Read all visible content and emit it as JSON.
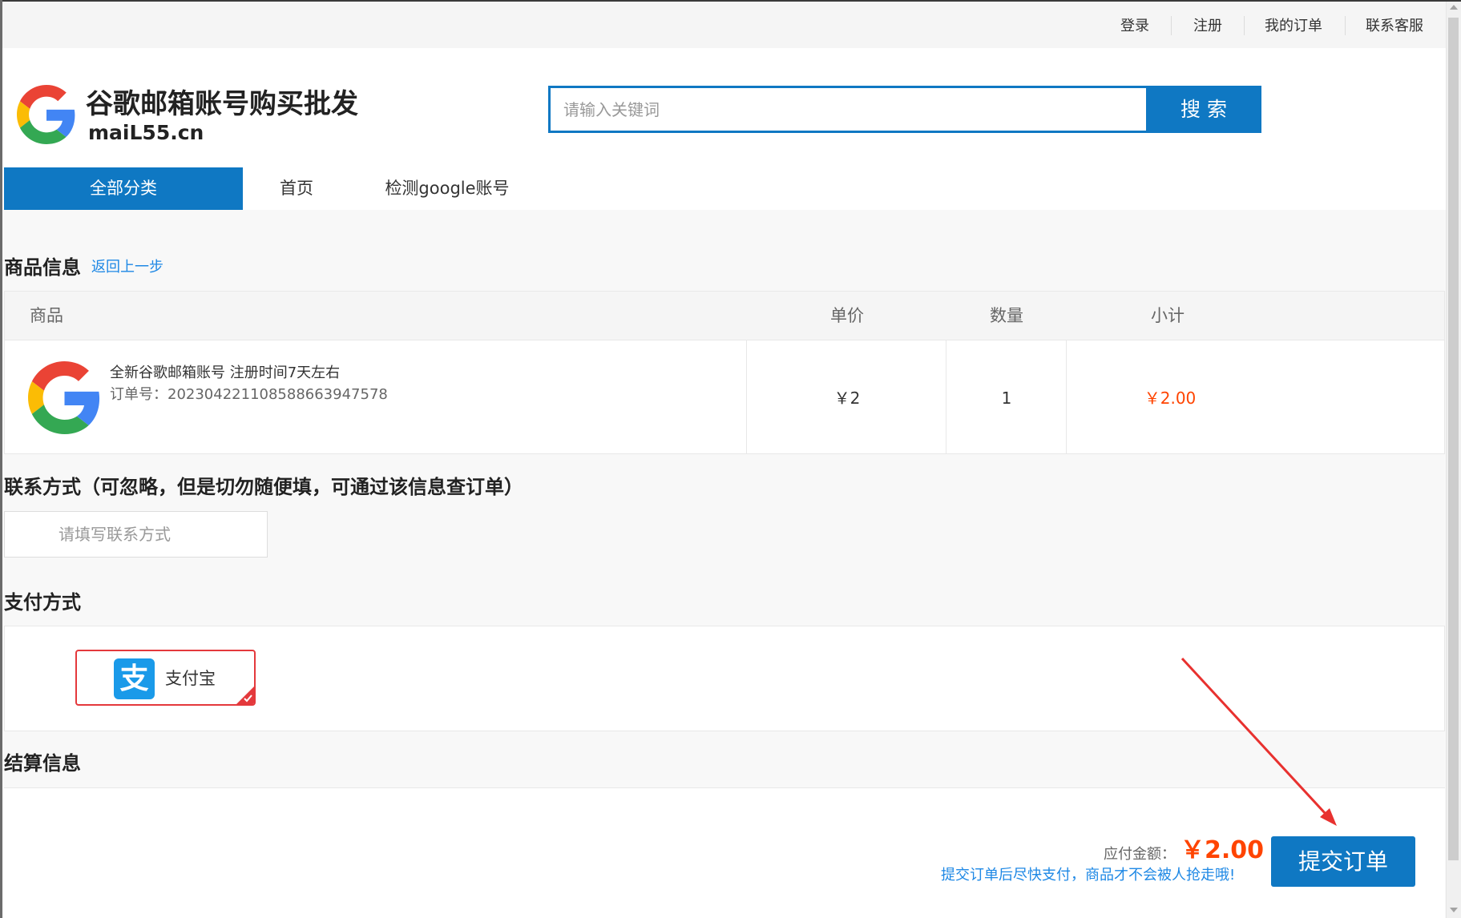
{
  "colors": {
    "accent": "#0f78c3",
    "price": "#ff4400",
    "link": "#1e88e5",
    "selected_border": "#e4393c",
    "annotation": "#e8312f"
  },
  "topbar": {
    "links": [
      {
        "label": "登录"
      },
      {
        "label": "注册"
      },
      {
        "label": "我的订单"
      },
      {
        "label": "联系客服"
      }
    ]
  },
  "header": {
    "logo_icon": "google-g-icon",
    "site_title": "谷歌邮箱账号购买批发",
    "site_domain": "maiL55.cn",
    "search": {
      "placeholder": "请输入关键词",
      "value": "",
      "button_label": "搜 索"
    }
  },
  "nav": {
    "items": [
      {
        "label": "全部分类",
        "active": true
      },
      {
        "label": "首页",
        "active": false
      },
      {
        "label": "检测google账号",
        "active": false
      }
    ]
  },
  "product_info": {
    "title": "商品信息",
    "back_link": "返回上一步",
    "columns": {
      "product": "商品",
      "unit_price": "单价",
      "quantity": "数量",
      "subtotal": "小计"
    },
    "items": [
      {
        "icon": "google-g-icon",
        "name": "全新谷歌邮箱账号 注册时间7天左右",
        "order_no": "订单号：202304221108588663947578",
        "unit_price": "￥2",
        "quantity": "1",
        "subtotal": "￥2.00"
      }
    ]
  },
  "contact": {
    "title": "联系方式（可忽略，但是切勿随便填，可通过该信息查订单）",
    "placeholder": "请填写联系方式",
    "value": ""
  },
  "payment": {
    "title": "支付方式",
    "options": [
      {
        "label": "支付宝",
        "icon": "alipay-icon",
        "icon_glyph": "支",
        "selected": true
      }
    ]
  },
  "settlement": {
    "title": "结算信息",
    "amount_label": "应付金额：",
    "amount": "￥2.00",
    "notice": "提交订单后尽快支付，商品才不会被人抢走哦!",
    "submit_label": "提交订单"
  }
}
